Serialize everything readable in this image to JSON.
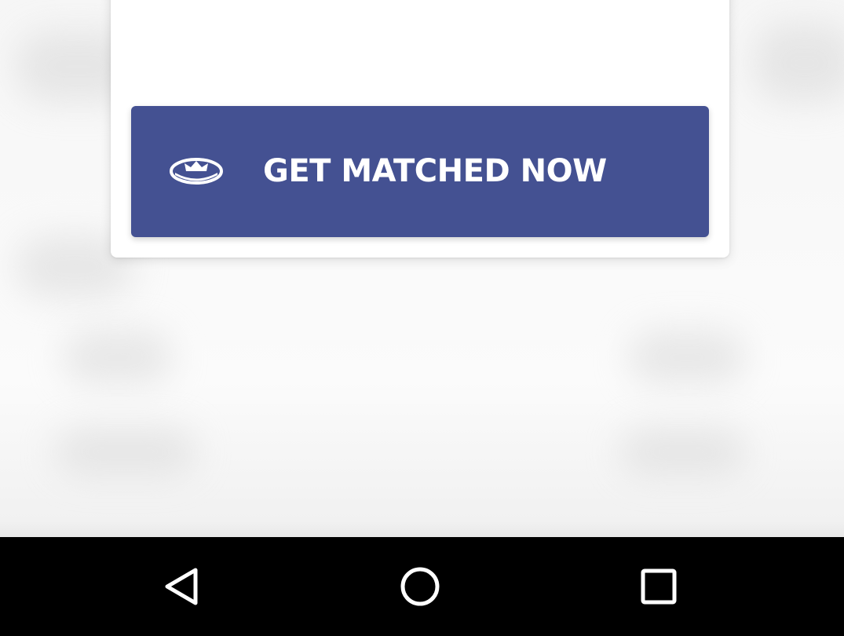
{
  "modal": {
    "cta_label": "GET MATCHED NOW",
    "cta_icon": "crown-badge-icon",
    "cta_color": "#445192"
  },
  "navigation_bar": {
    "back_icon": "back-triangle-icon",
    "home_icon": "home-circle-icon",
    "recents_icon": "recents-square-icon",
    "background": "#000000"
  }
}
